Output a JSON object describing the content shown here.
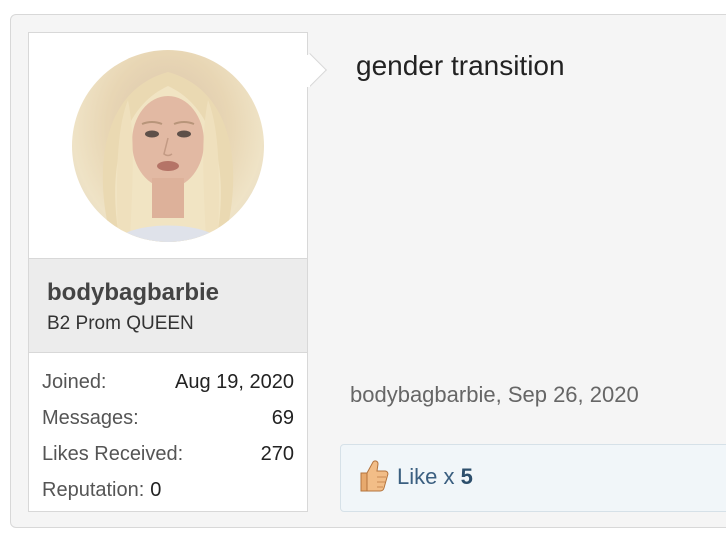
{
  "post": {
    "message": "gender transition",
    "author": "bodybagbarbie",
    "date": "Sep 26, 2020",
    "meta_sep": ", "
  },
  "user": {
    "name": "bodybagbarbie",
    "title": "B2 Prom QUEEN",
    "stats": [
      {
        "label": "Joined:",
        "value": "Aug 19, 2020"
      },
      {
        "label": "Messages:",
        "value": "69"
      },
      {
        "label": "Likes Received:",
        "value": "270"
      },
      {
        "label": "Reputation:",
        "value": "0"
      }
    ]
  },
  "likes": {
    "label": "Like x",
    "count": "5",
    "icon": "thumbs-up-icon"
  },
  "colors": {
    "panel_bg": "#f5f5f5",
    "like_bar_bg": "#f1f6f9",
    "like_text": "#3b5f80"
  }
}
